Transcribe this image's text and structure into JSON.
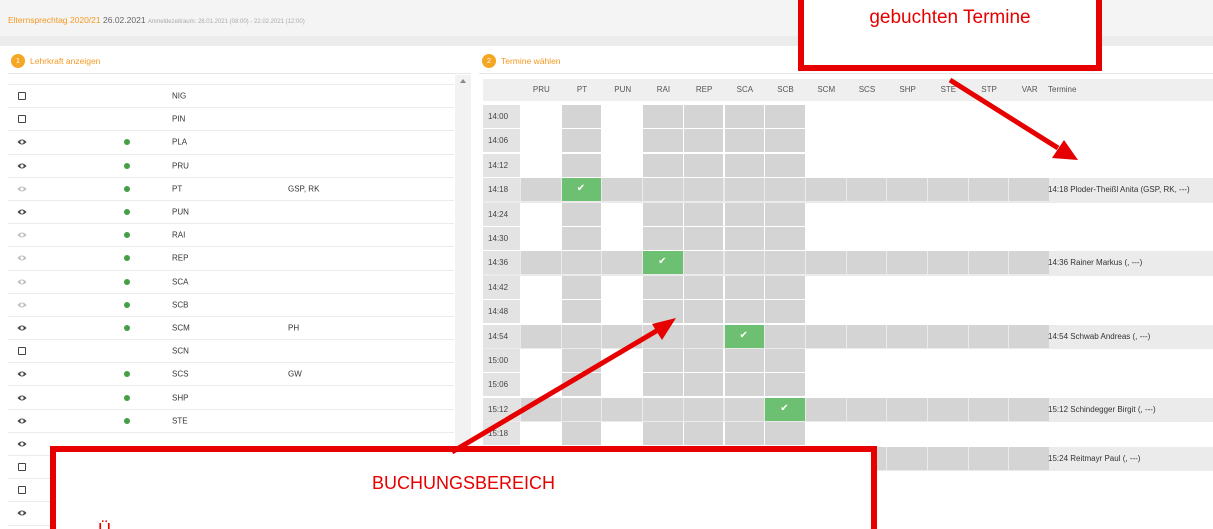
{
  "header": {
    "title": "Elternsprechtag 2020/21",
    "date": "26.02.2021",
    "registration": "Anmeldezeitraum: 28.01.2021 (08:00) - 22.02.2021 (12:00)"
  },
  "left_panel": {
    "step": "1",
    "title": "Lehrkraft anzeigen",
    "teachers": [
      {
        "icon": "checkbox",
        "online": false,
        "code": "NIG",
        "subjects": ""
      },
      {
        "icon": "checkbox",
        "online": false,
        "code": "PIN",
        "subjects": ""
      },
      {
        "icon": "eye",
        "online": true,
        "code": "PLA",
        "subjects": ""
      },
      {
        "icon": "eye",
        "online": true,
        "code": "PRU",
        "subjects": ""
      },
      {
        "icon": "eye-dim",
        "online": true,
        "code": "PT",
        "subjects": "GSP, RK"
      },
      {
        "icon": "eye",
        "online": true,
        "code": "PUN",
        "subjects": ""
      },
      {
        "icon": "eye-dim",
        "online": true,
        "code": "RAI",
        "subjects": ""
      },
      {
        "icon": "eye-dim",
        "online": true,
        "code": "REP",
        "subjects": ""
      },
      {
        "icon": "eye-dim",
        "online": true,
        "code": "SCA",
        "subjects": ""
      },
      {
        "icon": "eye-dim",
        "online": true,
        "code": "SCB",
        "subjects": ""
      },
      {
        "icon": "eye",
        "online": true,
        "code": "SCM",
        "subjects": "PH"
      },
      {
        "icon": "checkbox",
        "online": false,
        "code": "SCN",
        "subjects": ""
      },
      {
        "icon": "eye",
        "online": true,
        "code": "SCS",
        "subjects": "GW"
      },
      {
        "icon": "eye",
        "online": true,
        "code": "SHP",
        "subjects": ""
      },
      {
        "icon": "eye",
        "online": true,
        "code": "STE",
        "subjects": ""
      },
      {
        "icon": "eye",
        "online": false,
        "code": "",
        "subjects": ""
      },
      {
        "icon": "checkbox",
        "online": false,
        "code": "",
        "subjects": ""
      },
      {
        "icon": "checkbox",
        "online": false,
        "code": "",
        "subjects": ""
      },
      {
        "icon": "eye",
        "online": false,
        "code": "",
        "subjects": ""
      }
    ]
  },
  "right_panel": {
    "step": "2",
    "title": "Termine wählen",
    "columns": [
      "PRU",
      "PT",
      "PUN",
      "RAI",
      "REP",
      "SCA",
      "SCB",
      "SCM",
      "SCS",
      "SHP",
      "STE",
      "STP",
      "VAR"
    ],
    "termine_header": "Termine",
    "rows": [
      {
        "time": "14:00",
        "gray": [
          1,
          3,
          4,
          5,
          6
        ],
        "booked": [],
        "booking": ""
      },
      {
        "time": "14:06",
        "gray": [
          1,
          3,
          4,
          5,
          6
        ],
        "booked": [],
        "booking": ""
      },
      {
        "time": "14:12",
        "gray": [
          1,
          3,
          4,
          5,
          6
        ],
        "booked": [],
        "booking": ""
      },
      {
        "time": "14:18",
        "gray": [
          0,
          2,
          3,
          4,
          5,
          6,
          7,
          8,
          9,
          10,
          11,
          12
        ],
        "booked": [
          1
        ],
        "booking": "14:18 Ploder-Theißl Anita (GSP, RK, ---)"
      },
      {
        "time": "14:24",
        "gray": [
          1,
          3,
          4,
          5,
          6
        ],
        "booked": [],
        "booking": ""
      },
      {
        "time": "14:30",
        "gray": [
          1,
          3,
          4,
          5,
          6
        ],
        "booked": [],
        "booking": ""
      },
      {
        "time": "14:36",
        "gray": [
          0,
          1,
          2,
          4,
          5,
          6,
          7,
          8,
          9,
          10,
          11,
          12
        ],
        "booked": [
          3
        ],
        "booking": "14:36 Rainer Markus (, ---)"
      },
      {
        "time": "14:42",
        "gray": [
          1,
          3,
          4,
          5,
          6
        ],
        "booked": [],
        "booking": ""
      },
      {
        "time": "14:48",
        "gray": [
          1,
          3,
          4,
          5,
          6
        ],
        "booked": [],
        "booking": ""
      },
      {
        "time": "14:54",
        "gray": [
          0,
          1,
          2,
          3,
          4,
          6,
          7,
          8,
          9,
          10,
          11,
          12
        ],
        "booked": [
          5
        ],
        "booking": "14:54 Schwab Andreas (, ---)"
      },
      {
        "time": "15:00",
        "gray": [
          1,
          3,
          4,
          5,
          6
        ],
        "booked": [],
        "booking": ""
      },
      {
        "time": "15:06",
        "gray": [
          1,
          3,
          4,
          5,
          6
        ],
        "booked": [],
        "booking": ""
      },
      {
        "time": "15:12",
        "gray": [
          0,
          1,
          2,
          3,
          4,
          5,
          7,
          8,
          9,
          10,
          11,
          12
        ],
        "booked": [
          6
        ],
        "booking": "15:12 Schindegger Birgit (, ---)"
      },
      {
        "time": "15:18",
        "gray": [
          1,
          3,
          4,
          5,
          6
        ],
        "booked": [],
        "booking": ""
      },
      {
        "time": "",
        "gray": [
          0,
          1,
          2,
          3,
          4,
          5,
          6,
          7,
          8,
          9,
          10,
          11,
          12
        ],
        "booked": [],
        "booking": "15:24 Reitmayr Paul (, ---)"
      },
      {
        "time": "",
        "gray": [
          1,
          3,
          4,
          5,
          6
        ],
        "booked": [],
        "booking": ""
      },
      {
        "time": "",
        "gray": [
          1,
          3,
          4,
          5,
          6
        ],
        "booked": [],
        "booking": ""
      }
    ]
  },
  "annotations": {
    "top_callout": "gebuchten Termine",
    "bottom_callout": "BUCHUNGSBEREICH",
    "bottom_callout_line2": "Ü",
    "color": "#e60000"
  }
}
